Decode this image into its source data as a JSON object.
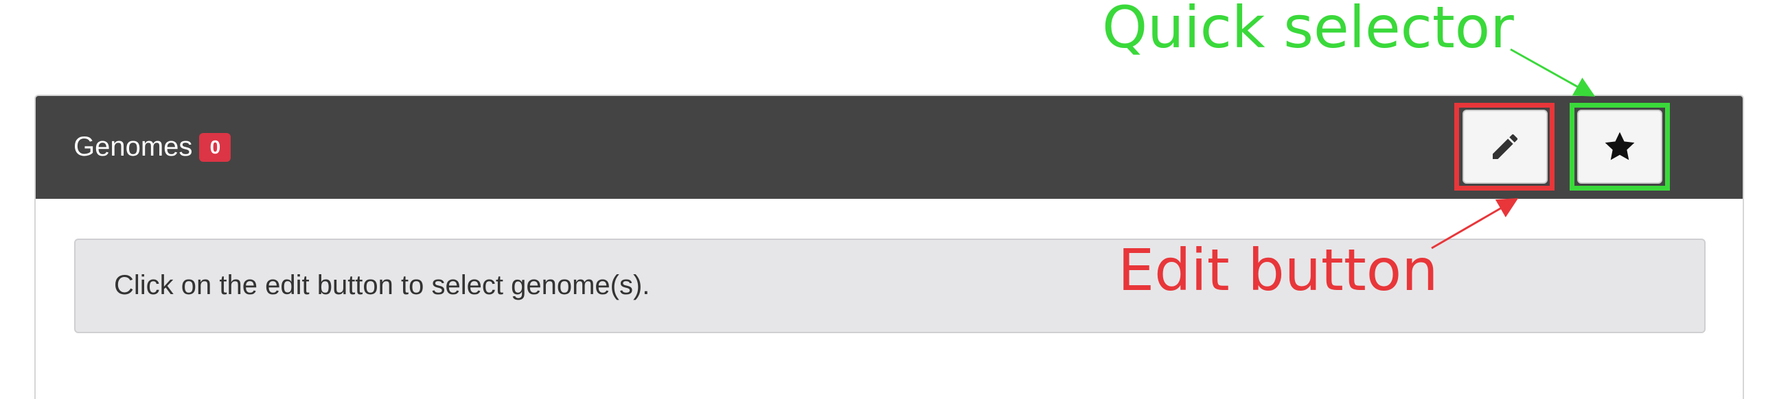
{
  "panel": {
    "title": "Genomes",
    "badge_count": "0",
    "edit_button_icon": "pencil-icon",
    "quick_selector_icon": "star-icon",
    "info_message": "Click on the edit button to select genome(s)."
  },
  "annotations": {
    "quick_selector_label": "Quick selector",
    "edit_button_label": "Edit button",
    "quick_selector_color": "#3ad93a",
    "edit_button_color": "#e8363a"
  },
  "colors": {
    "header_bg": "#444444",
    "badge_bg": "#dc3545",
    "info_bg": "#e6e6e8"
  }
}
